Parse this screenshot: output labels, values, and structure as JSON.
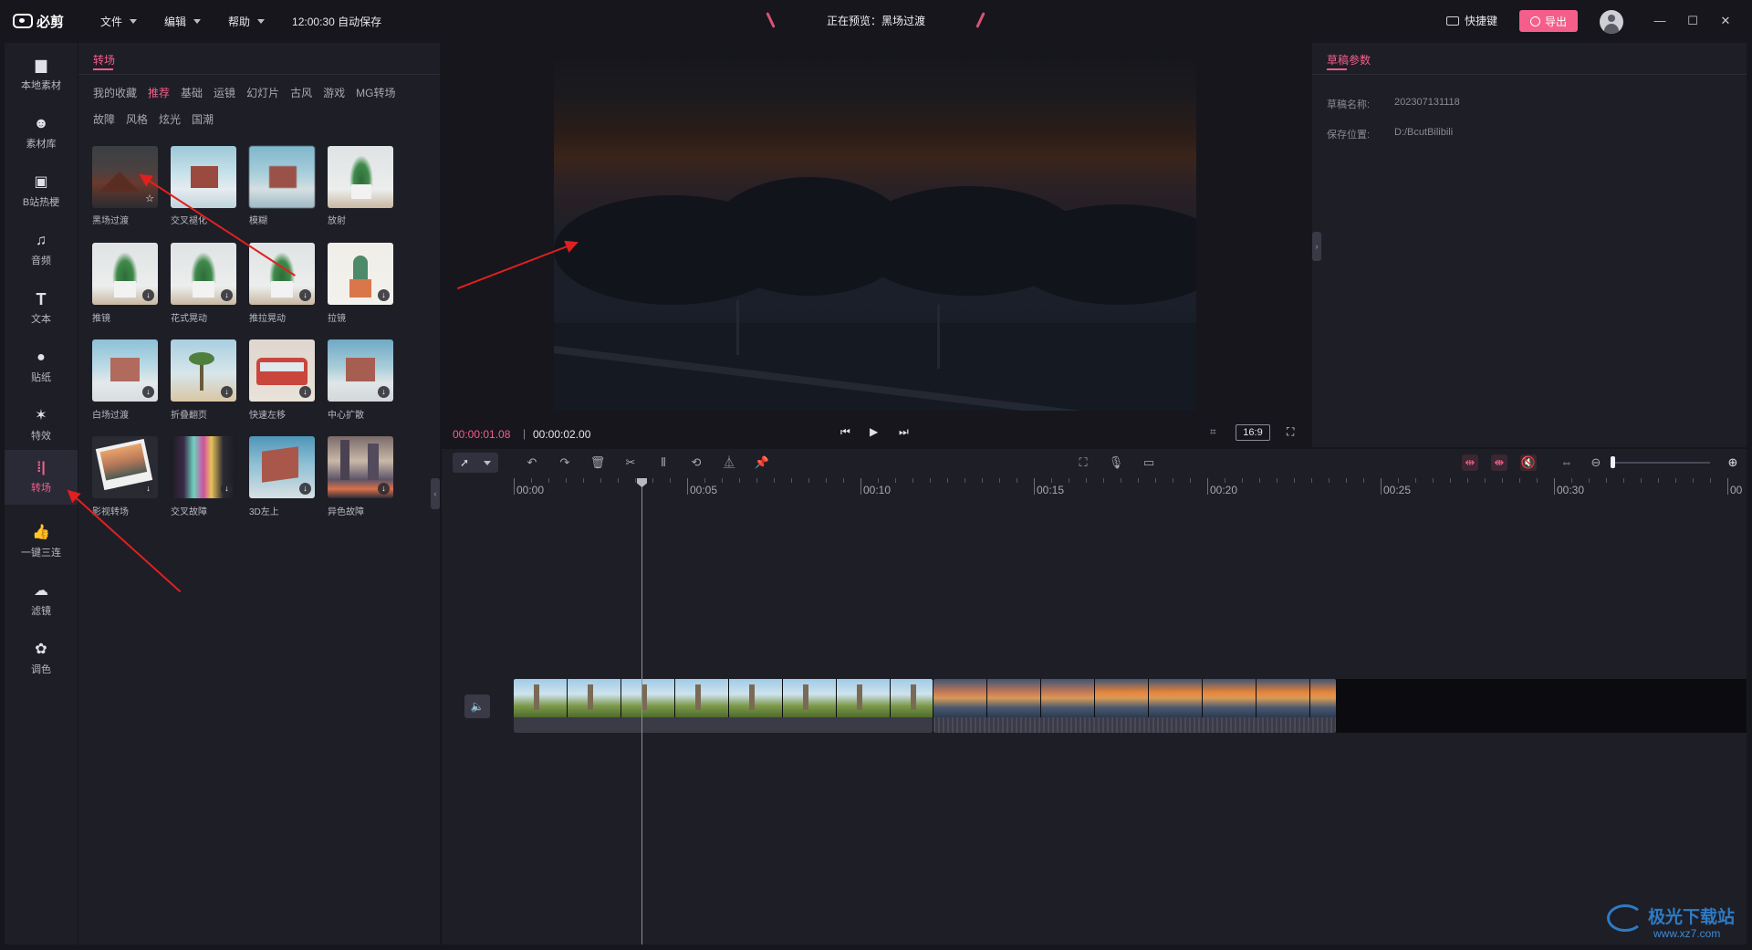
{
  "app": {
    "logo_text": "必剪",
    "menu": [
      {
        "label": "文件"
      },
      {
        "label": "编辑"
      },
      {
        "label": "帮助"
      }
    ],
    "autosave": "12:00:30 自动保存",
    "preview_title": "正在预览：黑场过渡",
    "shortcut_label": "快捷键",
    "export_label": "导出"
  },
  "leftnav": {
    "items": [
      {
        "label": "本地素材",
        "icon": "folder-upload-icon"
      },
      {
        "label": "素材库",
        "icon": "bili-tv-icon"
      },
      {
        "label": "B站热梗",
        "icon": "bili-hot-icon"
      },
      {
        "label": "音频",
        "icon": "music-note-icon"
      },
      {
        "label": "文本",
        "icon": "text-t-icon"
      },
      {
        "label": "贴纸",
        "icon": "sticker-icon"
      },
      {
        "label": "特效",
        "icon": "effect-star-icon"
      },
      {
        "label": "转场",
        "icon": "transition-icon",
        "active": true
      },
      {
        "label": "一键三连",
        "icon": "thumbs-up-icon"
      },
      {
        "label": "滤镜",
        "icon": "filter-circles-icon"
      },
      {
        "label": "调色",
        "icon": "palette-icon"
      }
    ]
  },
  "transitions": {
    "title": "转场",
    "categories_row1": [
      "我的收藏",
      "推荐",
      "基础",
      "运镜",
      "幻灯片",
      "古风",
      "游戏",
      "MG转场"
    ],
    "categories_row2": [
      "故障",
      "风格",
      "炫光",
      "国潮"
    ],
    "active_category": "推荐",
    "items": [
      {
        "label": "黑场过渡",
        "thumb": "dark-mountain"
      },
      {
        "label": "交叉褪化",
        "thumb": "house-blur"
      },
      {
        "label": "模糊",
        "thumb": "house-soft"
      },
      {
        "label": "放射",
        "thumb": "plant"
      },
      {
        "label": "推镜",
        "thumb": "plant"
      },
      {
        "label": "花式晃动",
        "thumb": "plant"
      },
      {
        "label": "推拉晃动",
        "thumb": "plant"
      },
      {
        "label": "拉镜",
        "thumb": "cactus"
      },
      {
        "label": "白场过渡",
        "thumb": "house"
      },
      {
        "label": "折叠翻页",
        "thumb": "palm"
      },
      {
        "label": "快速左移",
        "thumb": "bus"
      },
      {
        "label": "中心扩散",
        "thumb": "house"
      },
      {
        "label": "影视转场",
        "thumb": "photo-tilt"
      },
      {
        "label": "交叉故障",
        "thumb": "glitch"
      },
      {
        "label": "3D左上",
        "thumb": "house-3d"
      },
      {
        "label": "异色故障",
        "thumb": "city-glitch"
      }
    ]
  },
  "player": {
    "current_time": "00:00:01.08",
    "total_time": "00:00:02.00",
    "ratio": "16:9"
  },
  "params": {
    "title": "草稿参数",
    "rows": [
      {
        "label": "草稿名称:",
        "value": "202307131118"
      },
      {
        "label": "保存位置:",
        "value": "D:/BcutBilibili"
      }
    ]
  },
  "timeline": {
    "ticks": [
      "00:00",
      "00:05",
      "00:10",
      "00:15",
      "00:20",
      "00:25",
      "00:30",
      "00"
    ]
  },
  "watermark": {
    "text": "极光下载站",
    "url": "www.xz7.com"
  }
}
